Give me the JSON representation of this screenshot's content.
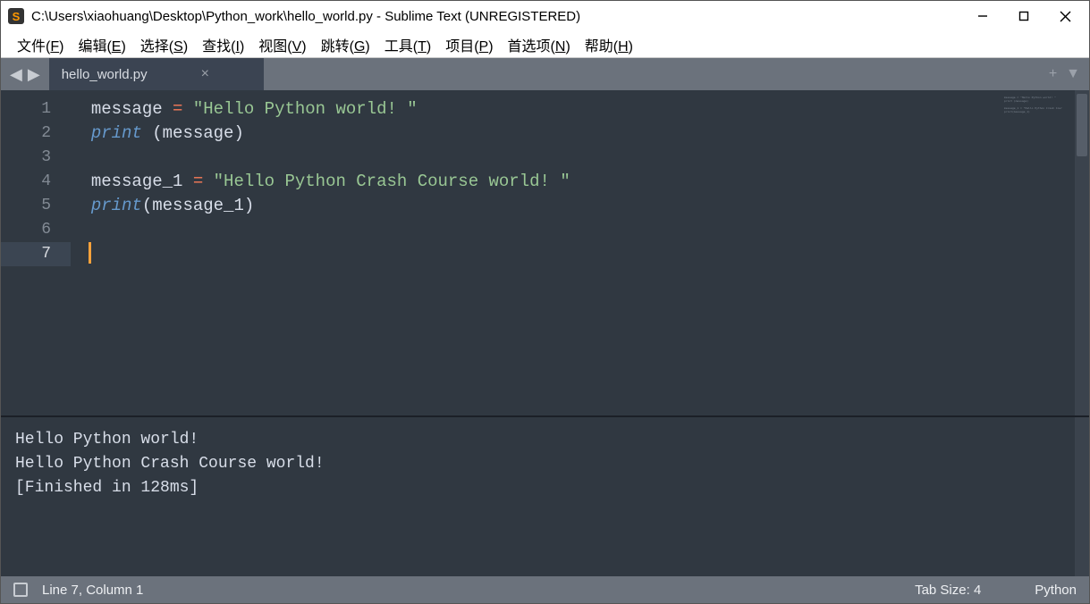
{
  "window": {
    "title": "C:\\Users\\xiaohuang\\Desktop\\Python_work\\hello_world.py - Sublime Text (UNREGISTERED)",
    "app_icon_letter": "S"
  },
  "menu": {
    "file": "文件(F)",
    "edit": "编辑(E)",
    "select": "选择(S)",
    "find": "查找(I)",
    "view": "视图(V)",
    "goto": "跳转(G)",
    "tools": "工具(T)",
    "project": "项目(P)",
    "preferences": "首选项(N)",
    "help": "帮助(H)"
  },
  "tabs": {
    "active_label": "hello_world.py"
  },
  "code": {
    "lines": [
      {
        "n": "1",
        "tokens": [
          [
            "var",
            "message"
          ],
          [
            "sp",
            " "
          ],
          [
            "op",
            "="
          ],
          [
            "sp",
            " "
          ],
          [
            "str",
            "\"Hello Python world! \""
          ]
        ]
      },
      {
        "n": "2",
        "tokens": [
          [
            "func",
            "print"
          ],
          [
            "sp",
            " "
          ],
          [
            "punc",
            "("
          ],
          [
            "var",
            "message"
          ],
          [
            "punc",
            ")"
          ]
        ]
      },
      {
        "n": "3",
        "tokens": []
      },
      {
        "n": "4",
        "tokens": [
          [
            "var",
            "message_1"
          ],
          [
            "sp",
            " "
          ],
          [
            "op",
            "="
          ],
          [
            "sp",
            " "
          ],
          [
            "str",
            "\"Hello Python Crash Course world! \""
          ]
        ]
      },
      {
        "n": "5",
        "tokens": [
          [
            "func",
            "print"
          ],
          [
            "punc",
            "("
          ],
          [
            "var",
            "message_1"
          ],
          [
            "punc",
            ")"
          ]
        ]
      },
      {
        "n": "6",
        "tokens": []
      },
      {
        "n": "7",
        "tokens": [],
        "active": true
      }
    ]
  },
  "console": {
    "lines": [
      "Hello Python world!",
      "Hello Python Crash Course world!",
      "[Finished in 128ms]"
    ]
  },
  "status": {
    "position": "Line 7, Column 1",
    "tab_size": "Tab Size: 4",
    "syntax": "Python"
  }
}
